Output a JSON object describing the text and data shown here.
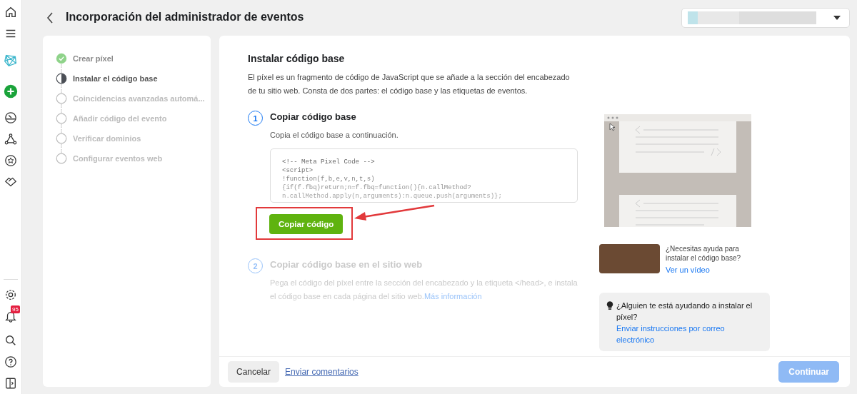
{
  "header": {
    "title": "Incorporación del administrador de eventos"
  },
  "notifications": {
    "badge": "95"
  },
  "steps": [
    {
      "label": "Crear píxel",
      "completed": true,
      "selected": false
    },
    {
      "label": "Instalar el código base",
      "completed": false,
      "selected": true
    },
    {
      "label": "Coincidencias avanzadas automá...",
      "completed": false,
      "selected": false
    },
    {
      "label": "Añadir código del evento",
      "completed": false,
      "selected": false
    },
    {
      "label": "Verificar dominios",
      "completed": false,
      "selected": false
    },
    {
      "label": "Configurar eventos web",
      "completed": false,
      "selected": false
    }
  ],
  "main": {
    "title": "Instalar código base",
    "intro": "El píxel es un fragmento de código de JavaScript que se añade a la sección del encabezado de tu sitio web. Consta de dos partes: el código base y las etiquetas de eventos.",
    "tasks": [
      {
        "number": "1",
        "title": "Copiar código base",
        "text": "Copia el código base a continuación.",
        "disabled": false,
        "code": [
          "<!-- Meta Pixel Code -->",
          "<script>",
          "!function(f,b,e,v,n,t,s)",
          "{if(f.fbq)return;n=f.fbq=function(){n.callMethod?",
          "n.callMethod.apply(n,arguments):n.queue.push(arguments)};"
        ],
        "button": "Copiar código"
      },
      {
        "number": "2",
        "title": "Copiar código base en el sitio web",
        "text": "Pega el código del píxel entre la sección del encabezado y la etiqueta </head>, e instala el código base en cada página del sitio web.",
        "link": "Más información",
        "disabled": true
      }
    ]
  },
  "help": {
    "question": "¿Necesitas ayuda para instalar el código base?",
    "link": "Ver un vídeo"
  },
  "tip": {
    "text": "¿Alguien te está ayudando a instalar el píxel?",
    "link": "Enviar instrucciones por correo electrónico"
  },
  "footer": {
    "cancel": "Cancelar",
    "feedback": "Enviar comentarios",
    "continue": {
      "label": "Continuar",
      "disabled": true
    }
  }
}
